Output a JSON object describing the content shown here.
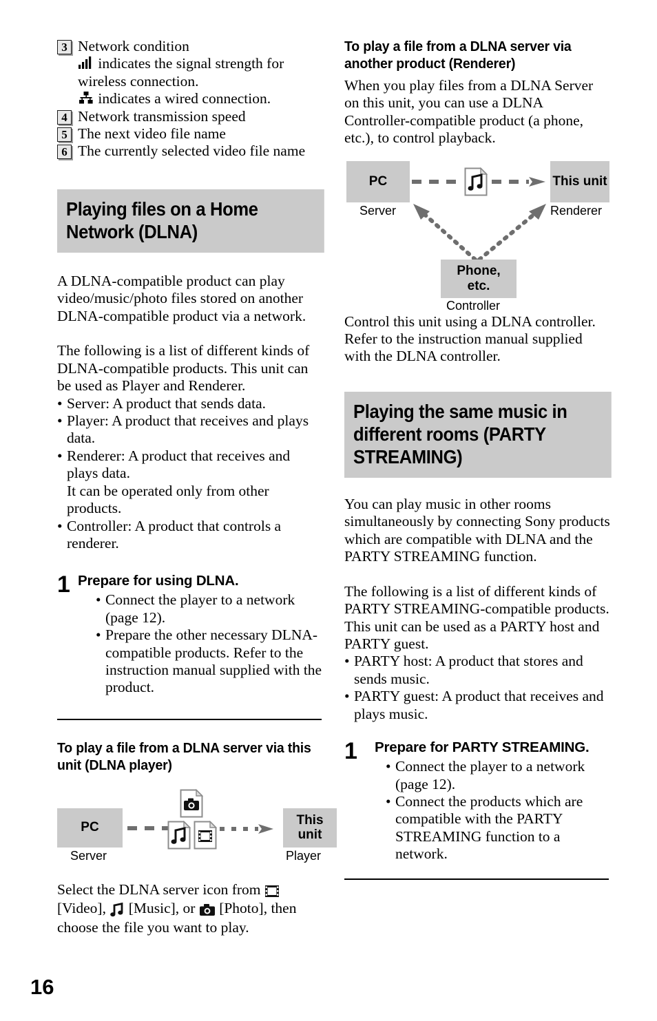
{
  "page": {
    "number": "16"
  },
  "left_column": {
    "callouts": [
      {
        "num": "3",
        "line1": "Network condition",
        "line2_icon": "signal-strength-icon",
        "line2": "indicates the signal strength for wireless connection.",
        "line3_icon": "wired-connection-icon",
        "line3": "indicates a wired connection."
      },
      {
        "num": "4",
        "line1": "Network transmission speed"
      },
      {
        "num": "5",
        "line1": "The next video file name"
      },
      {
        "num": "6",
        "line1": "The currently selected video file name"
      }
    ],
    "section_heading": "Playing files on a Home Network (DLNA)",
    "intro_para": "A DLNA-compatible product can play video/music/photo files stored on another DLNA-compatible product via a network.",
    "list_intro": "The following is a list of different kinds of DLNA-compatible products. This unit can be used as Player and Renderer.",
    "product_bullets": [
      {
        "text": "Server: A product that sends data."
      },
      {
        "text": "Player: A product that receives and plays data."
      },
      {
        "text": "Renderer: A product that receives and plays data.",
        "continuation": "It can be operated only from other products."
      },
      {
        "text": "Controller: A product that controls a renderer."
      }
    ],
    "step": {
      "num": "1",
      "title": "Prepare for using DLNA.",
      "bullets": [
        "Connect the player to a network (page 12).",
        "Prepare the other necessary DLNA-compatible products. Refer to the instruction manual supplied with the product."
      ]
    },
    "sub_heading": "To play a file from a DLNA server via this unit (DLNA player)",
    "diagram_player": {
      "source_box": "PC",
      "source_caption": "Server",
      "target_box": "This unit",
      "target_caption": "Player",
      "icons": [
        "photo-file-icon",
        "music-file-icon",
        "video-file-icon"
      ]
    },
    "after_diagram": {
      "part1": "Select the DLNA server icon from",
      "icon1": "video-icon",
      "part2": "[Video],",
      "icon2": "music-icon",
      "part3": "[Music], or",
      "icon3": "photo-icon",
      "part4": "[Photo], then choose the file you want to play."
    }
  },
  "right_column": {
    "sub_heading": "To play a file from a DLNA server via another product (Renderer)",
    "intro_para": "When you play files from a DLNA Server on this unit, you can use a DLNA Controller-compatible product (a phone, etc.), to control playback.",
    "diagram_renderer": {
      "source_box": "PC",
      "source_caption": "Server",
      "target_box": "This unit",
      "target_caption": "Renderer",
      "controller_box": "Phone, etc.",
      "controller_box_line1": "Phone,",
      "controller_box_line2": "etc.",
      "controller_caption": "Controller",
      "icon": "music-file-icon"
    },
    "after_diagram": "Control this unit using a DLNA controller. Refer to the instruction manual supplied with the DLNA controller.",
    "section_heading": "Playing the same music in different rooms (PARTY STREAMING)",
    "intro_para2": "You can play music in other rooms simultaneously by connecting Sony products which are compatible with DLNA and the PARTY STREAMING function.",
    "list_intro": "The following is a list of different kinds of PARTY STREAMING-compatible products. This unit can be used as a PARTY host and PARTY guest.",
    "product_bullets": [
      {
        "text": "PARTY host: A product that stores and sends music."
      },
      {
        "text": "PARTY guest: A product that receives and plays music."
      }
    ],
    "step": {
      "num": "1",
      "title": "Prepare for PARTY STREAMING.",
      "bullets": [
        "Connect the player to a network (page 12).",
        "Connect the products which are compatible with the PARTY STREAMING function to a network."
      ]
    }
  },
  "colors": {
    "band_gray": "#cacaca",
    "box_gray": "#cacaca",
    "arrow_gray": "#6e6e6e",
    "text_black": "#000000"
  }
}
